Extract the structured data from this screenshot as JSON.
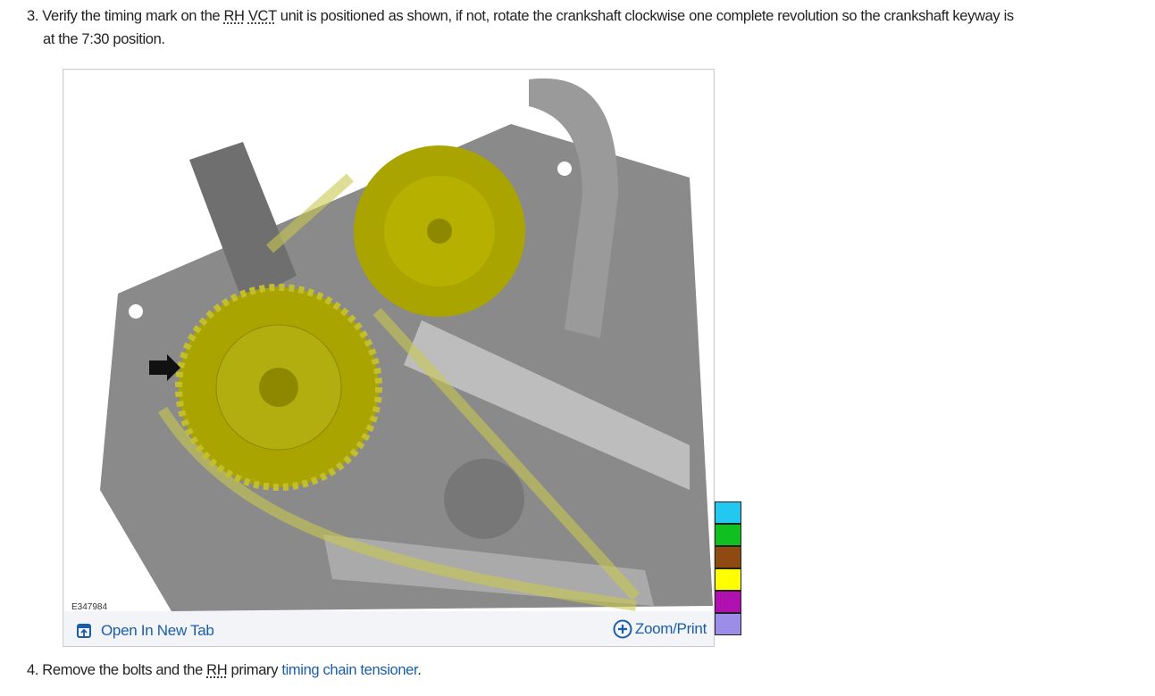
{
  "step3": {
    "number": "3.",
    "text_a": "Verify the timing mark on the",
    "abbr1": "RH",
    "abbr2": "VCT",
    "text_b": "unit is positioned as shown, if not, rotate the crankshaft clockwise one complete revolution so the crankshaft keyway is",
    "text_c": "at the 7:30 position."
  },
  "figure": {
    "id": "E347984",
    "open_tab_label": "Open In New Tab",
    "zoom_label": "Zoom/Print",
    "icons": {
      "open": "open-new-tab-icon",
      "zoom": "plus-circle-icon"
    }
  },
  "swatches": [
    "#22c8f0",
    "#10c020",
    "#8e4a10",
    "#ffff00",
    "#b010b0",
    "#9c8ee8"
  ],
  "step4": {
    "number": "4.",
    "text_a": "Remove the bolts and the",
    "abbr": "RH",
    "text_b": "primary",
    "link": "timing chain tensioner",
    "end": "."
  }
}
